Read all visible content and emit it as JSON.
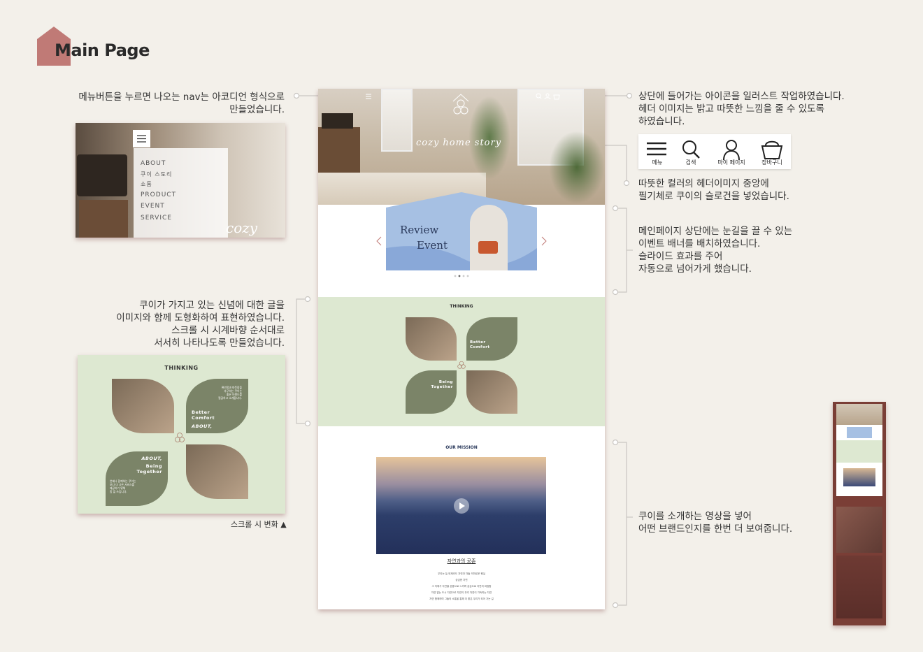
{
  "header": {
    "title": "Main Page"
  },
  "notes": {
    "nav": "메뉴버튼을 누르면 나오는 nav는 아코디언 형식으로\n만들었습니다.",
    "icons": "상단에 들어가는 아이콘을 일러스트 작업하였습니다.\n헤더 이미지는 밝고 따뜻한 느낌을 줄 수 있도록\n하였습니다.",
    "slogan": "따뜻한 컬러의 헤더이미지 중앙에\n필기체로 쿠이의 슬로건을 넣었습니다.",
    "banner": "메인페이지 상단에는 눈길을 끌 수 있는\n이벤트 배너를 배치하였습니다.\n슬라이드 효과를 주어\n자동으로 넘어가게 했습니다.",
    "thinking": "쿠이가 가지고 있는 신념에 대한 글을\n이미지와 함께 도형화하여 표현하였습니다.\n스크롤 시 시계바향 순서대로\n서서히 나타나도록 만들었습니다.",
    "video": "쿠이를 소개하는 영상을 넣어\n어떤 브랜드인지를 한번 더 보여줍니다.",
    "scroll_caption": "스크롤 시 변화 ▲"
  },
  "nav_menu": {
    "items": [
      "ABOUT",
      "쿠이 스토리",
      "쇼룸",
      "PRODUCT",
      "EVENT",
      "SERVICE"
    ],
    "slogan": "cozy hou"
  },
  "icon_bar": {
    "items": [
      {
        "icon": "menu-icon",
        "label": "메뉴"
      },
      {
        "icon": "search-icon",
        "label": "검색"
      },
      {
        "icon": "user-icon",
        "label": "마이 페이지"
      },
      {
        "icon": "basket-icon",
        "label": "장바구니"
      }
    ]
  },
  "main_mock": {
    "slogan": "cozy home story",
    "banner": {
      "line1": "Review",
      "line2": "Event"
    },
    "thinking_title": "THINKING",
    "comfort": {
      "title": "Better\nComfort",
      "sub": "ABOUT,",
      "text": "편안함과 따뜻함을\n추구하는 쿠이는\n좋은 브랜드를\n필굴하고 소개합니다."
    },
    "together": {
      "title": "Being\nTogether",
      "sub": "ABOUT,",
      "text": "언제나 함께하는 쿠이는\n보다 더 나은 서비스를\n제공하기 위해\n함 을 쓰입니다."
    },
    "mission_title": "OUR MISSION",
    "mission_sub": "자연과의 공존",
    "mission_lines": [
      "우리는 늘 언제라도 자연과 자들 의미로운 행실",
      "궁금한 자연",
      "그 자체가 자연을 존중으로 느끼며 궁금으로 자연의 바람합",
      "자연 없는 도시 자연으로 자연이 우리 자연이 가득하는 자연",
      "자연 함께하며 그들의 소통을 통해 더 좋은 우리가 되어 가는 길"
    ]
  },
  "colors": {
    "background": "#f3f0ea",
    "accent": "#c07a76",
    "sage": "#7b8468",
    "mint": "#dde8d1",
    "banner": "#a6c0e3"
  }
}
